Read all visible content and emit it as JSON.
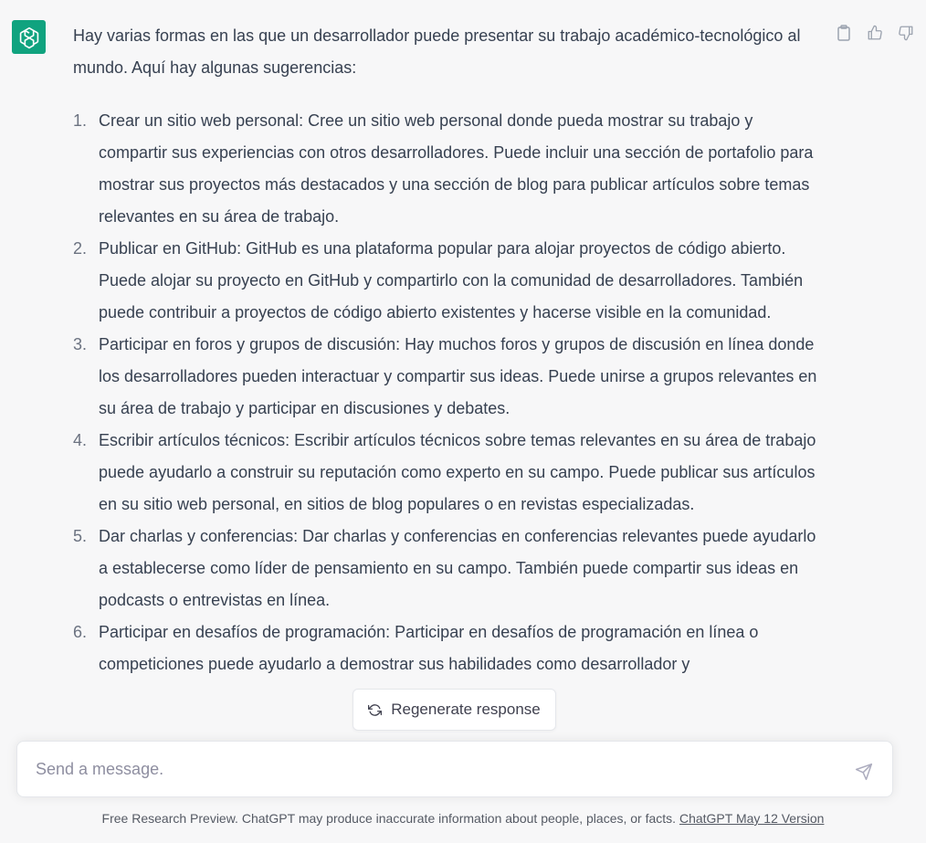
{
  "message": {
    "intro": "Hay varias formas en las que un desarrollador puede presentar su trabajo académico-tecnológico al mundo. Aquí hay algunas sugerencias:",
    "items": [
      {
        "num": "1.",
        "text": "Crear un sitio web personal: Cree un sitio web personal donde pueda mostrar su trabajo y compartir sus experiencias con otros desarrolladores. Puede incluir una sección de portafolio para mostrar sus proyectos más destacados y una sección de blog para publicar artículos sobre temas relevantes en su área de trabajo."
      },
      {
        "num": "2.",
        "text": "Publicar en GitHub: GitHub es una plataforma popular para alojar proyectos de código abierto. Puede alojar su proyecto en GitHub y compartirlo con la comunidad de desarrolladores. También puede contribuir a proyectos de código abierto existentes y hacerse visible en la comunidad."
      },
      {
        "num": "3.",
        "text": "Participar en foros y grupos de discusión: Hay muchos foros y grupos de discusión en línea donde los desarrolladores pueden interactuar y compartir sus ideas. Puede unirse a grupos relevantes en su área de trabajo y participar en discusiones y debates."
      },
      {
        "num": "4.",
        "text": "Escribir artículos técnicos: Escribir artículos técnicos sobre temas relevantes en su área de trabajo puede ayudarlo a construir su reputación como experto en su campo. Puede publicar sus artículos en su sitio web personal, en sitios de blog populares o en revistas especializadas."
      },
      {
        "num": "5.",
        "text": "Dar charlas y conferencias: Dar charlas y conferencias en conferencias relevantes puede ayudarlo a establecerse como líder de pensamiento en su campo. También puede compartir sus ideas en podcasts o entrevistas en línea."
      },
      {
        "num": "6.",
        "text": "Participar en desafíos de programación: Participar en desafíos de programación en línea o competiciones puede ayudarlo a demostrar sus habilidades como desarrollador y"
      }
    ]
  },
  "regenerate_label": "Regenerate response",
  "composer": {
    "placeholder": "Send a message."
  },
  "footer": {
    "text": "Free Research Preview. ChatGPT may produce inaccurate information about people, places, or facts.",
    "link": "ChatGPT May 12 Version"
  },
  "colors": {
    "avatar_bg": "#10a37f",
    "page_bg": "#f7f7f8"
  }
}
